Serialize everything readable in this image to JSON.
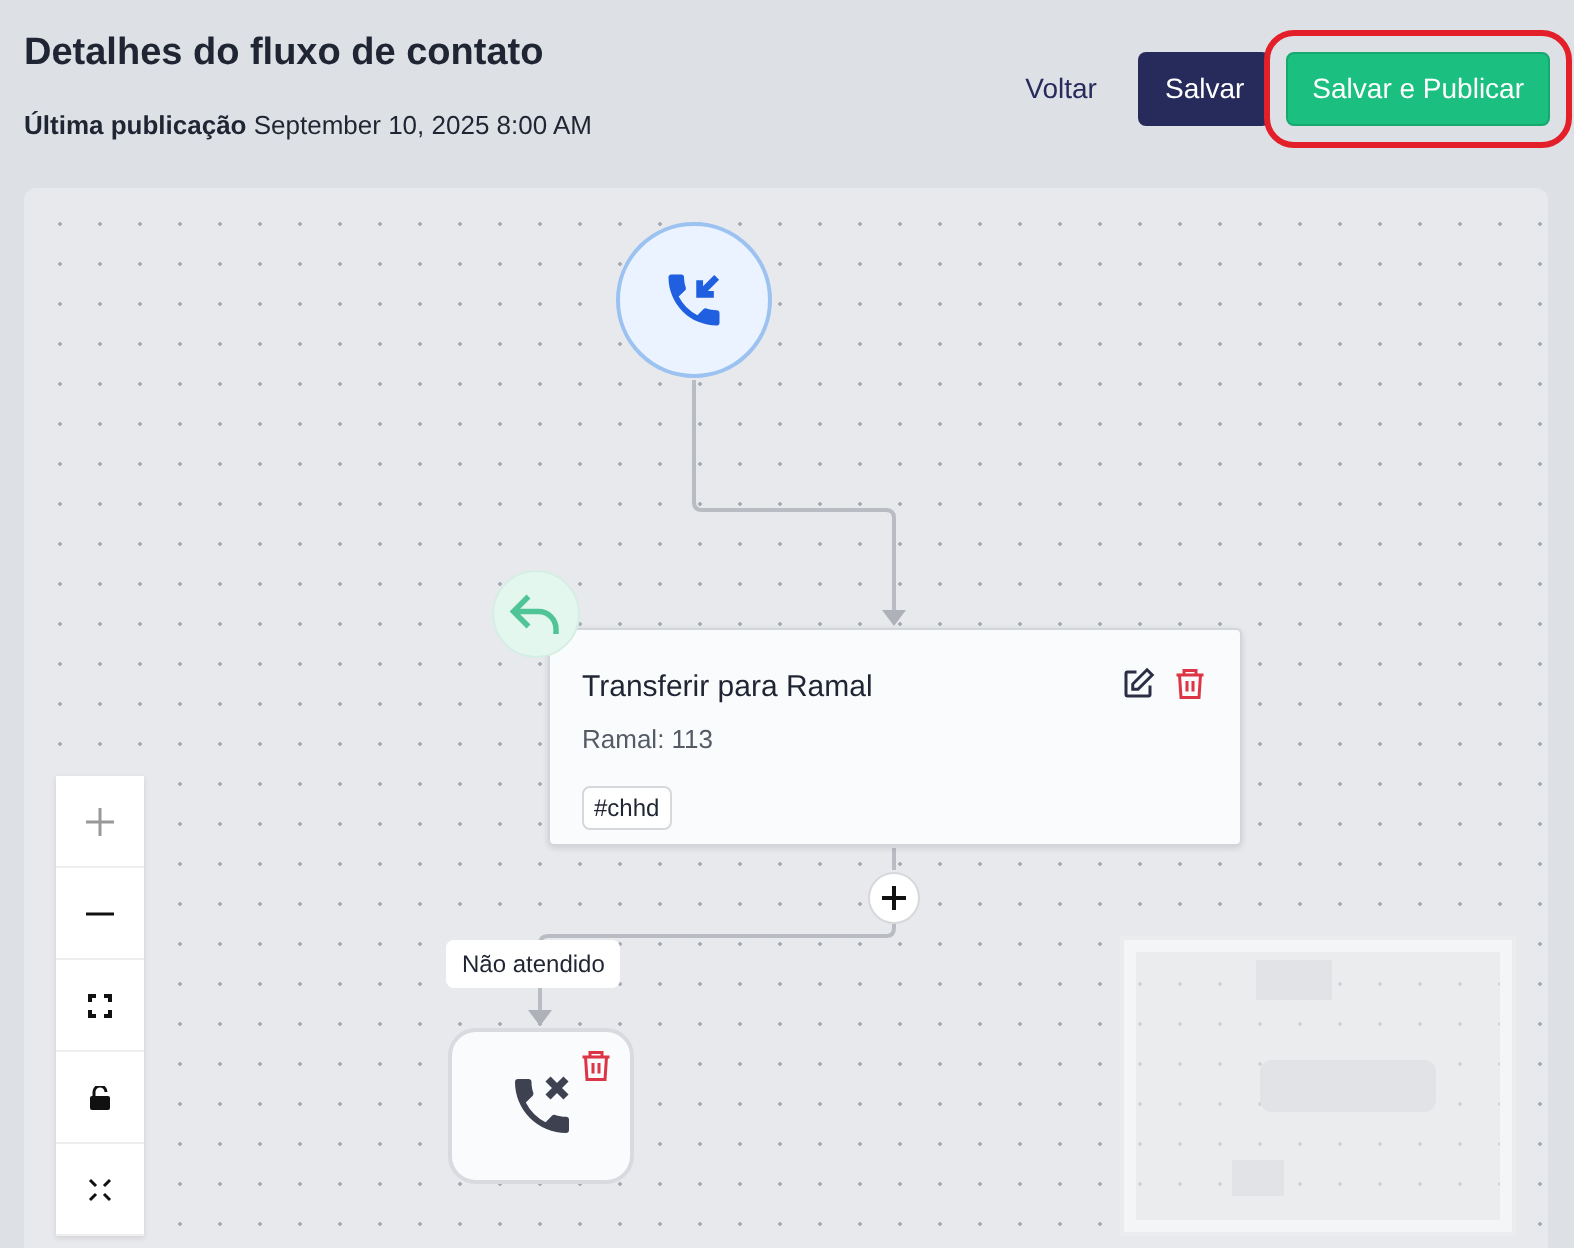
{
  "header": {
    "title": "Detalhes do fluxo de contato",
    "published_label": "Última publicação",
    "published_value": "September 10, 2025 8:00 AM"
  },
  "buttons": [
    {
      "label": "Voltar",
      "kind": "link",
      "highlighted": false
    },
    {
      "label": "Salvar",
      "kind": "dark",
      "highlighted": false
    },
    {
      "label": "Salvar e Publicar",
      "kind": "success",
      "highlighted": true
    }
  ],
  "flow": {
    "action_card": {
      "title": "Transferir para Ramal",
      "subtitle": "Ramal: 113",
      "tag": "#chhd"
    },
    "edge_label": "Não atendido"
  }
}
